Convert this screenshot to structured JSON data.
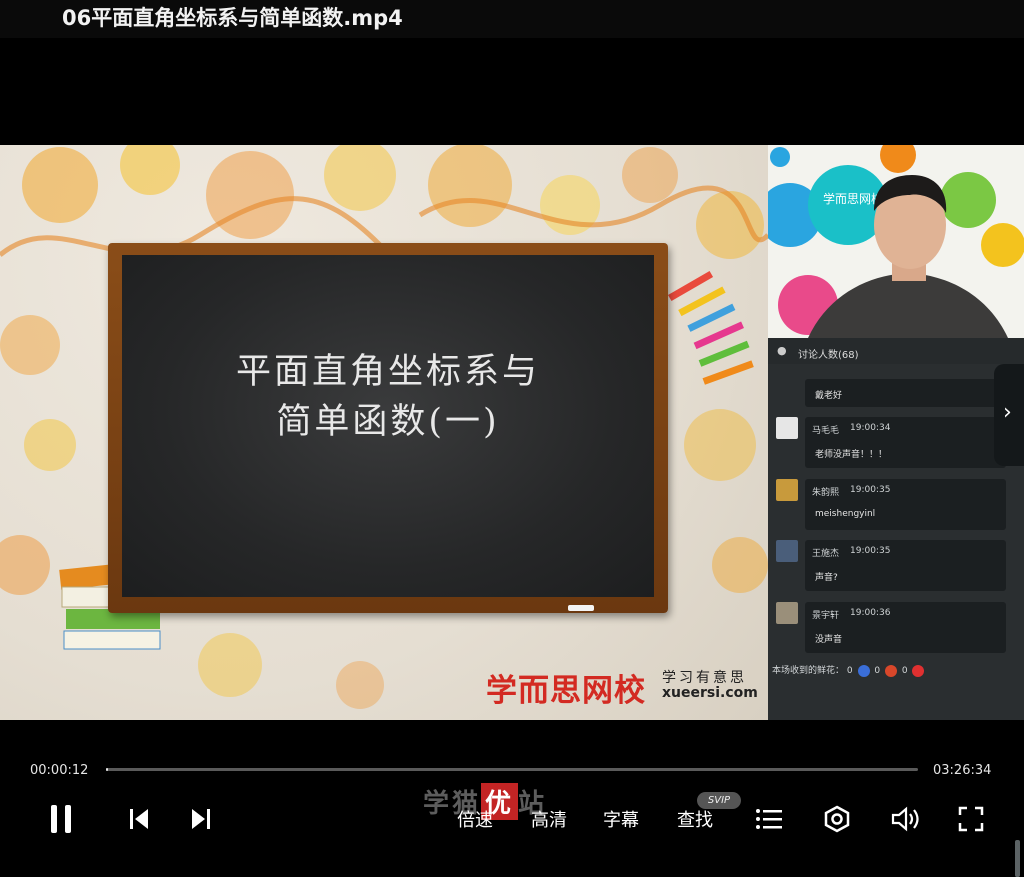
{
  "window": {
    "title": "06平面直角坐标系与简单函数.mp4"
  },
  "slide": {
    "heading_line1": "平面直角坐标系与",
    "heading_line2": "简单函数(一)",
    "brand_cn": "学而思网校",
    "brand_slogan": "学习有意思",
    "brand_url": "xueersi.com"
  },
  "camera": {
    "banner_text": "学而思网校"
  },
  "chat": {
    "header_label": "讨论人数(68)",
    "messages": [
      {
        "name": "",
        "time": "",
        "text": "戴老好"
      },
      {
        "name": "马毛毛",
        "time": "19:00:34",
        "text": "老师没声音！！！"
      },
      {
        "name": "朱韵熙",
        "time": "19:00:35",
        "text": "meishengyinl"
      },
      {
        "name": "王施杰",
        "time": "19:00:35",
        "text": "声音?"
      },
      {
        "name": "景宇轩",
        "time": "19:00:36",
        "text": "没声音"
      }
    ],
    "flowers_label": "本场收到的鲜花：",
    "flower_counts": [
      "0",
      "0",
      "0"
    ]
  },
  "player": {
    "current_time": "00:00:12",
    "total_time": "03:26:34",
    "progress_fraction": 0.001,
    "speed_label": "倍速",
    "quality_label": "高清",
    "subtitle_label": "字幕",
    "find_label": "查找",
    "svip_badge": "SVIP"
  },
  "watermark": {
    "left": "学猫",
    "mid": "优",
    "right": "站"
  },
  "icons": {
    "play_pause": "pause-icon",
    "prev": "skip-previous-icon",
    "next": "skip-next-icon",
    "playlist": "playlist-icon",
    "settings": "settings-icon",
    "volume": "volume-icon",
    "fullscreen": "fullscreen-icon",
    "panel_toggle": "chevron-right-icon"
  },
  "colors": {
    "brand_red": "#d32a22",
    "player_bg": "#000000"
  }
}
